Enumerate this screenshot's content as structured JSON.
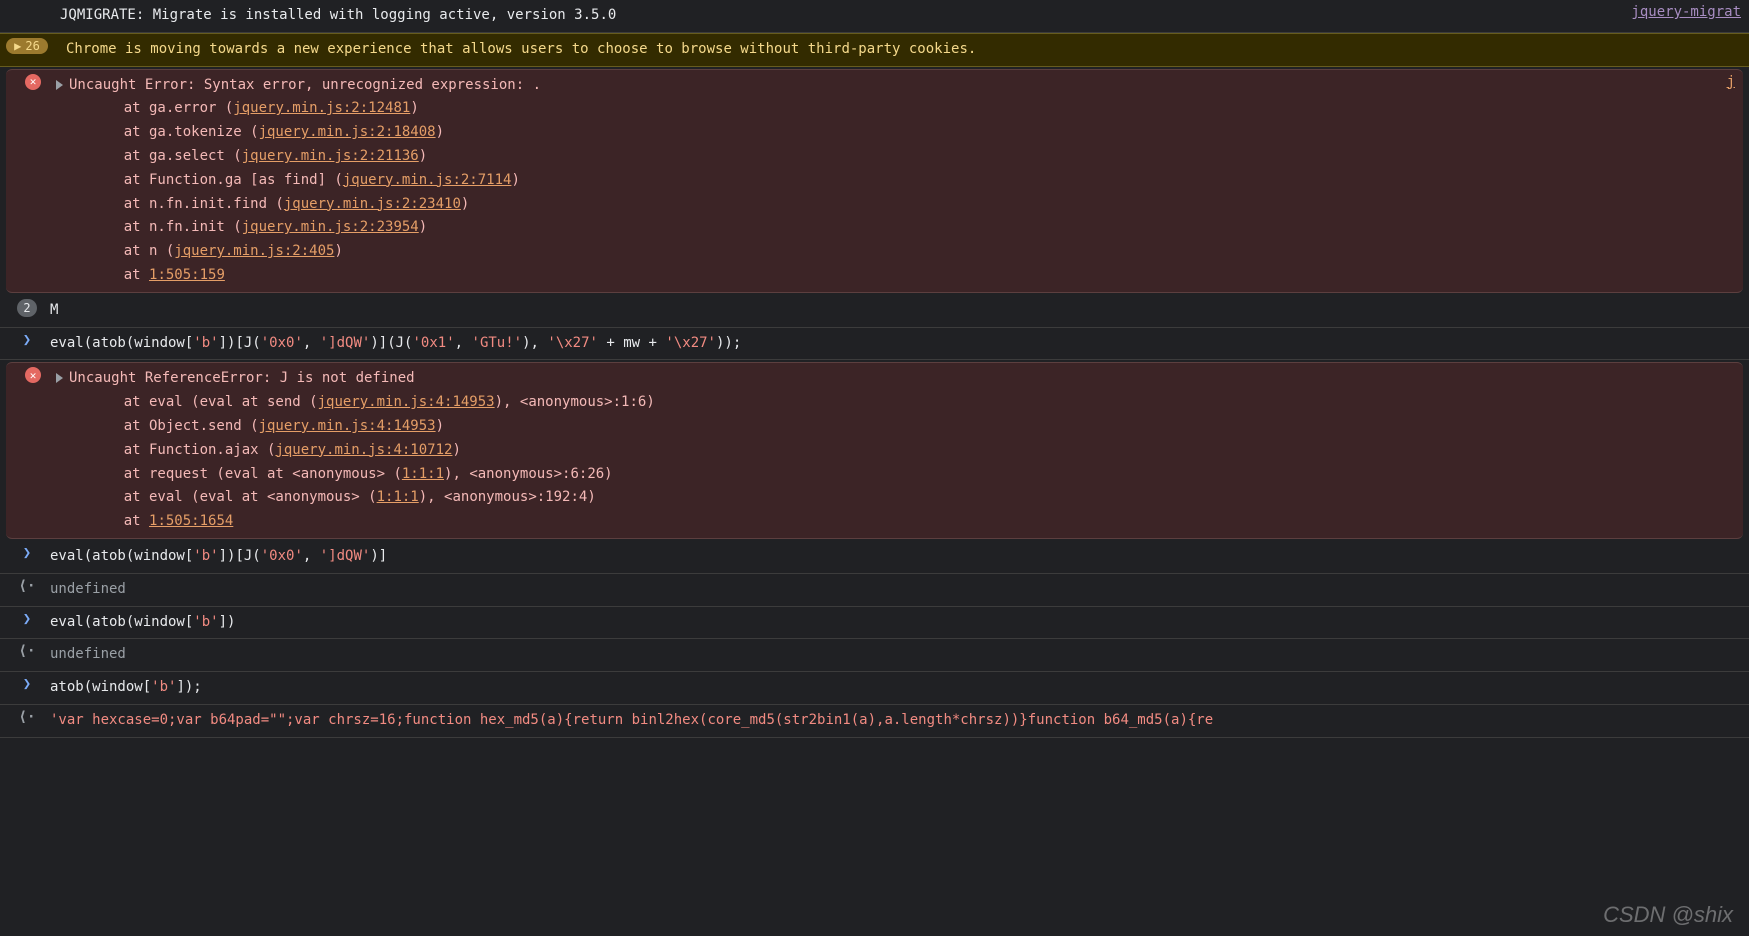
{
  "rows": [
    {
      "kind": "log",
      "text": "JQMIGRATE: Migrate is installed with logging active, version 3.5.0",
      "source": "jquery-migrat"
    },
    {
      "kind": "warning",
      "badge_count": "26",
      "text": "Chrome is moving towards a new experience that allows users to choose to browse without third-party cookies."
    },
    {
      "kind": "error",
      "title": "Uncaught Error: Syntax error, unrecognized expression: .",
      "source": "j",
      "stack": [
        {
          "prefix": "at ga.error (",
          "link": "jquery.min.js:2:12481",
          "suffix": ")"
        },
        {
          "prefix": "at ga.tokenize (",
          "link": "jquery.min.js:2:18408",
          "suffix": ")"
        },
        {
          "prefix": "at ga.select (",
          "link": "jquery.min.js:2:21136",
          "suffix": ")"
        },
        {
          "prefix": "at Function.ga [as find] (",
          "link": "jquery.min.js:2:7114",
          "suffix": ")"
        },
        {
          "prefix": "at n.fn.init.find (",
          "link": "jquery.min.js:2:23410",
          "suffix": ")"
        },
        {
          "prefix": "at n.fn.init (",
          "link": "jquery.min.js:2:23954",
          "suffix": ")"
        },
        {
          "prefix": "at n (",
          "link": "jquery.min.js:2:405",
          "suffix": ")"
        },
        {
          "prefix": "at ",
          "link": "1:505:159",
          "suffix": ""
        }
      ]
    },
    {
      "kind": "log-count",
      "count": "2",
      "text": "M"
    },
    {
      "kind": "input",
      "code_parts": [
        {
          "t": "plain",
          "v": "eval(atob(window["
        },
        {
          "t": "str",
          "v": "'b'"
        },
        {
          "t": "plain",
          "v": "])[J("
        },
        {
          "t": "str",
          "v": "'0x0'"
        },
        {
          "t": "plain",
          "v": ", "
        },
        {
          "t": "str",
          "v": "']dQW'"
        },
        {
          "t": "plain",
          "v": ")](J("
        },
        {
          "t": "str",
          "v": "'0x1'"
        },
        {
          "t": "plain",
          "v": ", "
        },
        {
          "t": "str",
          "v": "'GTu!'"
        },
        {
          "t": "plain",
          "v": "), "
        },
        {
          "t": "str",
          "v": "'\\x27'"
        },
        {
          "t": "plain",
          "v": " + mw + "
        },
        {
          "t": "str",
          "v": "'\\x27'"
        },
        {
          "t": "plain",
          "v": "));"
        }
      ]
    },
    {
      "kind": "error",
      "title": "Uncaught ReferenceError: J is not defined",
      "stack": [
        {
          "prefix": "at eval (eval at send (",
          "link": "jquery.min.js:4:14953",
          "suffix": "), <anonymous>:1:6)"
        },
        {
          "prefix": "at Object.send (",
          "link": "jquery.min.js:4:14953",
          "suffix": ")"
        },
        {
          "prefix": "at Function.ajax (",
          "link": "jquery.min.js:4:10712",
          "suffix": ")"
        },
        {
          "prefix": "at request (eval at <anonymous> (",
          "link": "1:1:1",
          "suffix": "), <anonymous>:6:26)"
        },
        {
          "prefix": "at eval (eval at <anonymous> (",
          "link": "1:1:1",
          "suffix": "), <anonymous>:192:4)"
        },
        {
          "prefix": "at ",
          "link": "1:505:1654",
          "suffix": ""
        }
      ]
    },
    {
      "kind": "input",
      "code_parts": [
        {
          "t": "plain",
          "v": "eval(atob(window["
        },
        {
          "t": "str",
          "v": "'b'"
        },
        {
          "t": "plain",
          "v": "])[J("
        },
        {
          "t": "str",
          "v": "'0x0'"
        },
        {
          "t": "plain",
          "v": ", "
        },
        {
          "t": "str",
          "v": "']dQW'"
        },
        {
          "t": "plain",
          "v": ")]"
        }
      ]
    },
    {
      "kind": "output",
      "text": "undefined"
    },
    {
      "kind": "input",
      "code_parts": [
        {
          "t": "plain",
          "v": "eval(atob(window["
        },
        {
          "t": "str",
          "v": "'b'"
        },
        {
          "t": "plain",
          "v": "])"
        }
      ]
    },
    {
      "kind": "output",
      "text": "undefined"
    },
    {
      "kind": "input",
      "code_parts": [
        {
          "t": "plain",
          "v": "atob(window["
        },
        {
          "t": "str",
          "v": "'b'"
        },
        {
          "t": "plain",
          "v": "]);"
        }
      ]
    },
    {
      "kind": "result",
      "text": "'var hexcase=0;var b64pad=\"\";var chrsz=16;function hex_md5(a){return binl2hex(core_md5(str2bin1(a),a.length*chrsz))}function b64_md5(a){re"
    }
  ],
  "watermark": "CSDN @shix"
}
